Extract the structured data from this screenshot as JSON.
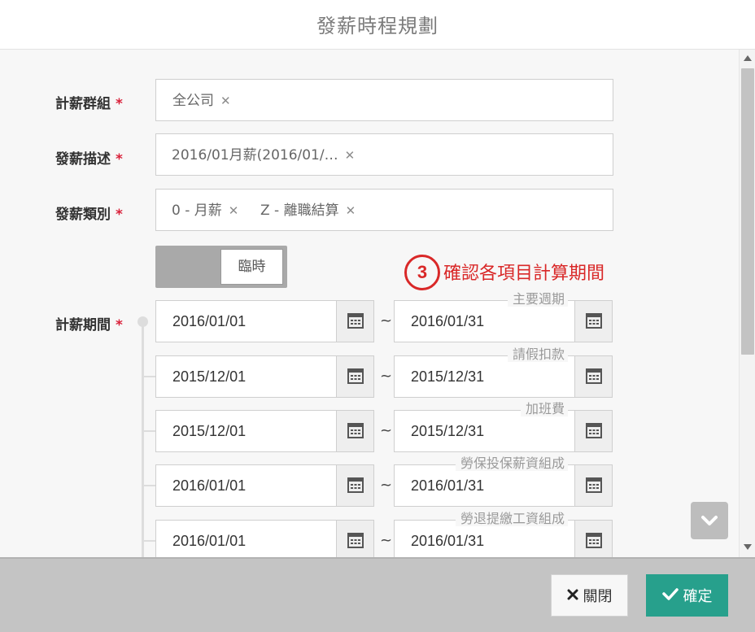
{
  "dialog": {
    "title": "發薪時程規劃"
  },
  "form": {
    "required_mark": "*",
    "salary_group": {
      "label": "計薪群組",
      "tags": [
        "全公司"
      ]
    },
    "pay_description": {
      "label": "發薪描述",
      "tags": [
        "2016/01月薪(2016/01/…"
      ]
    },
    "pay_category": {
      "label": "發薪類別",
      "tags": [
        "0 - 月薪",
        "Z - 離職結算"
      ]
    },
    "temporary_toggle": {
      "label": "臨時",
      "on": false
    },
    "pay_period": {
      "label": "計薪期間",
      "separator": "~",
      "rows": [
        {
          "category": "主要週期",
          "start": "2016/01/01",
          "end": "2016/01/31"
        },
        {
          "category": "請假扣款",
          "start": "2015/12/01",
          "end": "2015/12/31"
        },
        {
          "category": "加班費",
          "start": "2015/12/01",
          "end": "2015/12/31"
        },
        {
          "category": "勞保投保薪資組成",
          "start": "2016/01/01",
          "end": "2016/01/31"
        },
        {
          "category": "勞退提繳工資組成",
          "start": "2016/01/01",
          "end": "2016/01/31"
        }
      ]
    }
  },
  "annotation": {
    "number": "3",
    "text": "確認各項目計算期間",
    "color": "#d92828"
  },
  "footer": {
    "close_label": "關閉",
    "confirm_label": "確定"
  },
  "colors": {
    "accent": "#27a08c",
    "required": "#d9213a"
  },
  "icons": {
    "tag_remove": "close-icon",
    "date_picker": "calendar-icon",
    "scroll_down": "chevron-down-icon",
    "close": "close-icon",
    "confirm": "check-icon"
  }
}
